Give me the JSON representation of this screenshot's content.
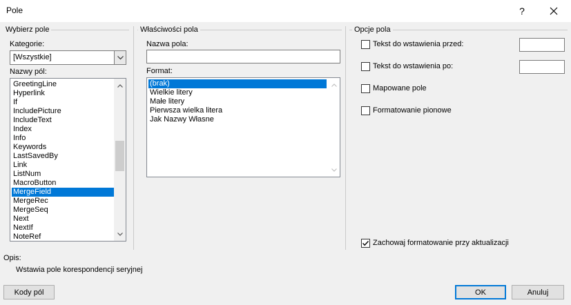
{
  "window": {
    "title": "Pole",
    "help_glyph": "?",
    "close_glyph": "✕"
  },
  "choose_field": {
    "group_label": "Wybierz pole",
    "category_label": "Kategorie:",
    "category_value": "[Wszystkie]",
    "field_names_label": "Nazwy pól:",
    "fields": [
      "GreetingLine",
      "Hyperlink",
      "If",
      "IncludePicture",
      "IncludeText",
      "Index",
      "Info",
      "Keywords",
      "LastSavedBy",
      "Link",
      "ListNum",
      "MacroButton",
      "MergeField",
      "MergeRec",
      "MergeSeq",
      "Next",
      "NextIf",
      "NoteRef"
    ],
    "selected_index": 12
  },
  "field_properties": {
    "group_label": "Właściwości pola",
    "field_name_label": "Nazwa pola:",
    "field_name_value": "",
    "format_label": "Format:",
    "formats": [
      "(brak)",
      "Wielkie litery",
      "Małe litery",
      "Pierwsza wielka litera",
      "Jak Nazwy Własne"
    ],
    "selected_format_index": 0
  },
  "field_options": {
    "group_label": "Opcje pola",
    "text_before_label": "Tekst do wstawienia przed:",
    "text_before_checked": false,
    "text_before_value": "",
    "text_after_label": "Tekst do wstawienia po:",
    "text_after_checked": false,
    "text_after_value": "",
    "mapped_field_label": "Mapowane pole",
    "mapped_field_checked": false,
    "vertical_format_label": "Formatowanie pionowe",
    "vertical_format_checked": false,
    "preserve_format_label": "Zachowaj formatowanie przy aktualizacji",
    "preserve_format_checked": true
  },
  "description": {
    "label": "Opis:",
    "text": "Wstawia pole korespondencji seryjnej"
  },
  "buttons": {
    "field_codes": "Kody pól",
    "ok": "OK",
    "cancel": "Anuluj"
  }
}
